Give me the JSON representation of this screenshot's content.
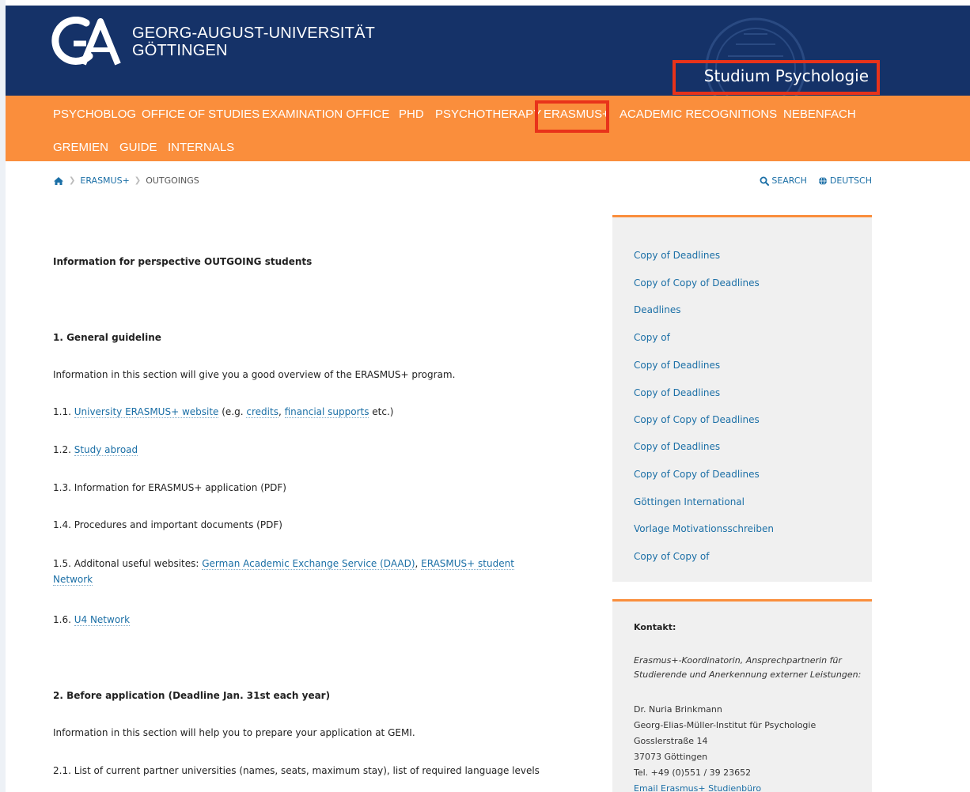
{
  "header": {
    "logo_line1": "GEORG-AUGUST-UNIVERSITÄT",
    "logo_line2": "GÖTTINGEN",
    "site_title": "Studium Psychologie",
    "colors": {
      "header_bg": "#153268",
      "nav_bg": "#fa8e3c",
      "highlight": "#e8331a"
    }
  },
  "nav": {
    "items": [
      "PSYCHOBLOG",
      "OFFICE OF STUDIES",
      "EXAMINATION OFFICE",
      "PHD",
      "PSYCHOTHERAPY",
      "ERASMUS+",
      "ACADEMIC RECOGNITIONS",
      "NEBENFACH",
      "GREMIEN",
      "GUIDE",
      "INTERNALS"
    ],
    "active": "ERASMUS+"
  },
  "breadcrumb": {
    "home_icon": "home-icon",
    "items": [
      "ERASMUS+",
      "OUTGOINGS"
    ]
  },
  "tools": {
    "search": "SEARCH",
    "language": "DEUTSCH"
  },
  "content": {
    "intro": "Information for perspective OUTGOING students",
    "s1_title": "1. General guideline",
    "s1_desc": "Information in this section will give you a good overview of the ERASMUS+ program.",
    "i11_pre": "1.1. ",
    "i11_link": "University ERASMUS+ website",
    "i11_mid": " (e.g. ",
    "i11_link2": "credits",
    "i11_comma": ", ",
    "i11_link3": "financial supports",
    "i11_post": " etc.)",
    "i12_pre": "1.2. ",
    "i12_link": "Study abroad",
    "i13": "1.3. Information for ERASMUS+ application (PDF)",
    "i14": "1.4. Procedures and important documents (PDF)",
    "i15_pre": "1.5. Additonal useful websites: ",
    "i15_link1": "German Academic Exchange Service (DAAD)",
    "i15_comma": ", ",
    "i15_link2a": "ERASMUS+ student",
    "i15_link2b": "Network",
    "i16_pre": "1.6. ",
    "i16_link": "U4 Network",
    "s2_title": "2. Before application (Deadline Jan. 31st each year)",
    "s2_desc": "Information in this section will help you to prepare your application at GEMI.",
    "i21": "2.1. List of current partner universities (names, seats, maximum stay), list of required language levels"
  },
  "sidebar": {
    "links": [
      "Copy of Deadlines",
      "Copy of Copy of Deadlines",
      "Deadlines",
      "Copy of",
      "Copy of Deadlines",
      "Copy of Deadlines",
      "Copy of Copy of Deadlines",
      "Copy of Deadlines",
      "Copy of Copy of Deadlines",
      "Göttingen International",
      "Vorlage Motivationsschreiben",
      "Copy of Copy of"
    ]
  },
  "contact": {
    "title": "Kontakt:",
    "role": "Erasmus+-Koordinatorin, Ansprechpartnerin für Studierende und Anerkennung externer Leistungen:",
    "name": "Dr. Nuria Brinkmann",
    "institute": "Georg-Elias-Müller-Institut für Psychologie",
    "street": "Gosslerstraße 14",
    "city": "37073 Göttingen",
    "phone": "Tel. +49 (0)551 / 39 23652",
    "email": "Email Erasmus+ Studienbüro"
  }
}
